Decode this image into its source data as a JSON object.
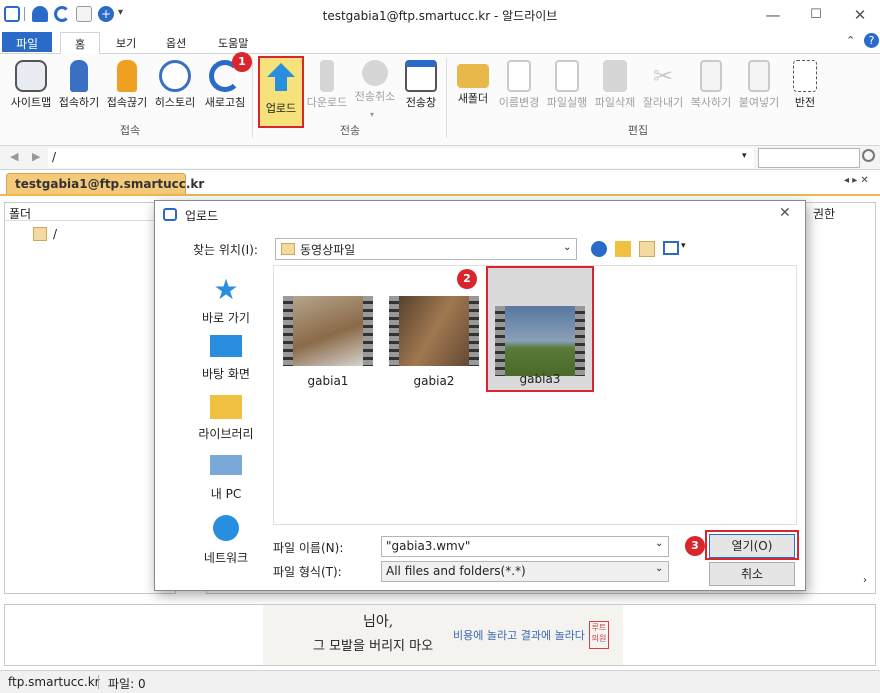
{
  "window": {
    "title": "testgabia1@ftp.smartucc.kr - 알드라이브"
  },
  "ribbon_tabs": [
    "파일",
    "홈",
    "보기",
    "옵션",
    "도움말"
  ],
  "ribbon": {
    "buttons": [
      {
        "label": "사이트맵",
        "icon": "sitemap-icon"
      },
      {
        "label": "접속하기",
        "icon": "plug-icon"
      },
      {
        "label": "접속끊기",
        "icon": "unplug-icon"
      },
      {
        "label": "히스토리",
        "icon": "clock-icon"
      },
      {
        "label": "새로고침",
        "icon": "refresh-icon"
      },
      {
        "label": "업로드",
        "icon": "upload-arrow-icon"
      },
      {
        "label": "다운로드",
        "icon": "download-arrow-icon"
      },
      {
        "label": "전송취소",
        "icon": "cancel-transfer-icon"
      },
      {
        "label": "전송창",
        "icon": "transfer-window-icon"
      },
      {
        "label": "새폴더",
        "icon": "new-folder-icon"
      },
      {
        "label": "이름변경",
        "icon": "rename-icon"
      },
      {
        "label": "파일실행",
        "icon": "run-file-icon"
      },
      {
        "label": "파일삭제",
        "icon": "delete-file-icon"
      },
      {
        "label": "잘라내기",
        "icon": "scissors-icon"
      },
      {
        "label": "복사하기",
        "icon": "copy-icon"
      },
      {
        "label": "붙여넣기",
        "icon": "paste-icon"
      },
      {
        "label": "반전",
        "icon": "invert-selection-icon"
      }
    ],
    "groups": [
      "접속",
      "전송",
      "편집"
    ]
  },
  "address": {
    "path": "/"
  },
  "connection_tab": "testgabia1@ftp.smartucc.kr",
  "left_panel": {
    "header": "폴더",
    "root": "/"
  },
  "right_panel": {
    "header_perm": "권한"
  },
  "dialog": {
    "title": "업로드",
    "lookin_label": "찾는 위치(I):",
    "lookin_value": "동영상파일",
    "places": [
      "바로 가기",
      "바탕 화면",
      "라이브러리",
      "내 PC",
      "네트워크"
    ],
    "files": [
      "gabia1",
      "gabia2",
      "gabia3"
    ],
    "filename_label": "파일 이름(N):",
    "filename_value": "\"gabia3.wmv\"",
    "filetype_label": "파일 형식(T):",
    "filetype_value": "All files and folders(*.*)",
    "open_label": "열기(O)",
    "cancel_label": "취소"
  },
  "badges": [
    "1",
    "2",
    "3"
  ],
  "ad": {
    "line1": "님아,",
    "line2": "그 모발을 버리지 마오",
    "line3": "비용에 놀라고 결과에 놀라다",
    "stamp": "루트의원"
  },
  "status": {
    "host": "ftp.smartucc.kr",
    "files": "파일: 0"
  },
  "colors": {
    "accent": "#2a6ac8",
    "highlight": "#f5e27a",
    "badge": "#d9262c",
    "tab": "#f5c97a"
  }
}
